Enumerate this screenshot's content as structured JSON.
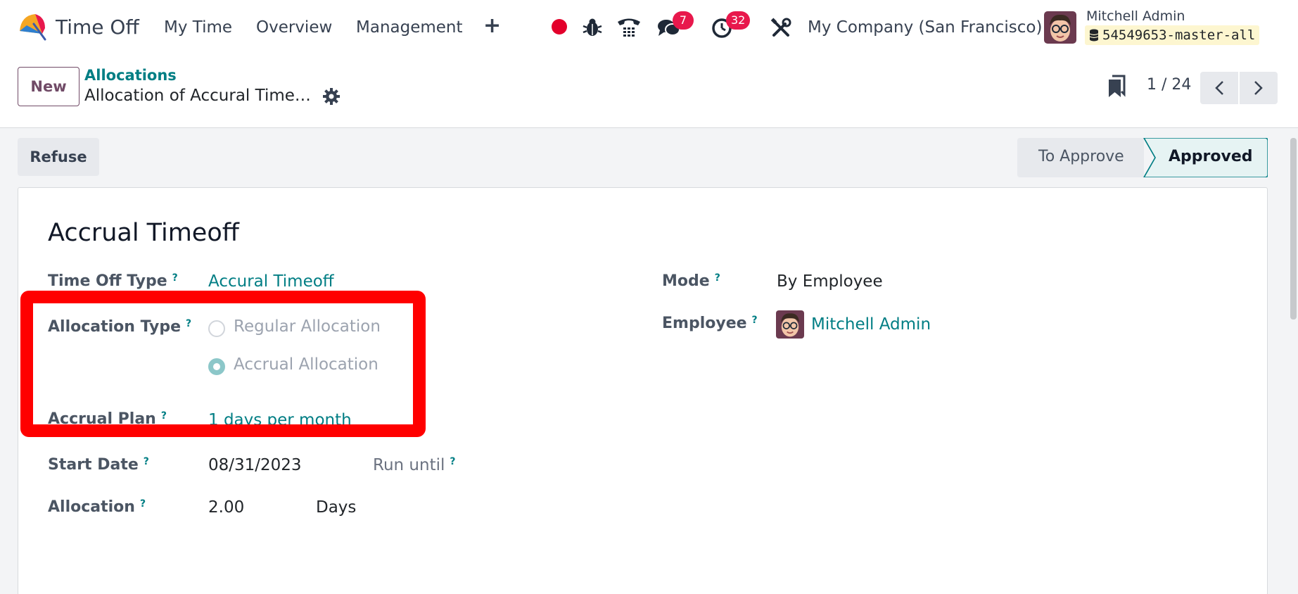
{
  "navbar": {
    "app_name": "Time Off",
    "menu": [
      "My Time",
      "Overview",
      "Management"
    ],
    "plus": "+",
    "messages_badge": "7",
    "activities_badge": "32",
    "company": "My Company (San Francisco)",
    "user_name": "Mitchell Admin",
    "database": "54549653-master-all"
  },
  "control": {
    "new_label": "New",
    "breadcrumb_parent": "Allocations",
    "breadcrumb_current": "Allocation of Accural Time…",
    "pager": "1 / 24"
  },
  "statusbar": {
    "refuse_label": "Refuse",
    "stages": [
      "To Approve",
      "Approved"
    ],
    "active_stage": "Approved"
  },
  "form": {
    "title": "Accrual Timeoff",
    "help": "?",
    "time_off_type_label": "Time Off Type",
    "time_off_type_value": "Accural Timeoff",
    "allocation_type_label": "Allocation Type",
    "allocation_options": [
      "Regular Allocation",
      "Accrual Allocation"
    ],
    "allocation_selected": "Accrual Allocation",
    "accrual_plan_label": "Accrual Plan",
    "accrual_plan_value": "1 days per month",
    "start_date_label": "Start Date",
    "start_date_value": "08/31/2023",
    "run_until_label": "Run until",
    "allocation_label": "Allocation",
    "allocation_value": "2.00",
    "allocation_unit": "Days",
    "mode_label": "Mode",
    "mode_value": "By Employee",
    "employee_label": "Employee",
    "employee_value": "Mitchell Admin"
  },
  "colors": {
    "brand": "#714b67",
    "link": "#017e84",
    "highlight": "#ff0000",
    "badge": "#e8184c"
  }
}
